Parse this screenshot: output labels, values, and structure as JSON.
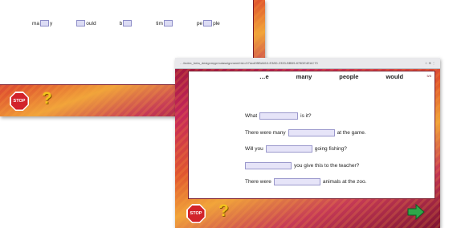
{
  "back_screen": {
    "words": [
      {
        "before": "ma",
        "after": "y"
      },
      {
        "before": "",
        "after": "ould"
      },
      {
        "before": "b",
        "after": ""
      },
      {
        "before": "tim",
        "after": ""
      },
      {
        "before": "pe",
        "after": "ple"
      }
    ],
    "stop_label": "STOP",
    "help_label": "?"
  },
  "front_screen": {
    "browser_url": "…/index_beta_designmyp/outassignment/rid=/47dcd0BBA810-E38D-2333-BBB9-878DE4EAC70",
    "browser_controls": "☆ ⊕ ⋮",
    "counter": "5/5",
    "word_bank": [
      "…e",
      "many",
      "people",
      "would"
    ],
    "sentences": [
      {
        "before": "What",
        "after": "is it?"
      },
      {
        "before": "There were many",
        "after": "at the game."
      },
      {
        "before": "Will you",
        "after": "going fishing?"
      },
      {
        "before": "",
        "after": "you give this to the teacher?"
      },
      {
        "before": "There were",
        "after": "animals at the zoo."
      }
    ],
    "stop_label": "STOP",
    "help_label": "?"
  },
  "colors": {
    "background_gradient_start": "#9a1638",
    "background_gradient_mid": "#f0a43a",
    "stop_red": "#d2232a",
    "help_yellow": "#f2c21e",
    "arrow_green": "#2fa64a",
    "blank_fill": "#dcdcf4"
  },
  "icons": [
    "stop-sign-icon",
    "question-mark-icon",
    "next-arrow-icon"
  ]
}
